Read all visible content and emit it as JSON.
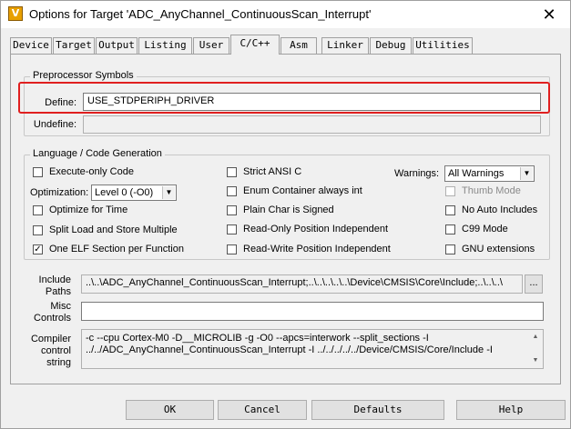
{
  "window": {
    "title": "Options for Target 'ADC_AnyChannel_ContinuousScan_Interrupt'",
    "app_icon_glyph": "V",
    "close_glyph": "✕"
  },
  "tabs": [
    "Device",
    "Target",
    "Output",
    "Listing",
    "User",
    "C/C++",
    "Asm",
    "Linker",
    "Debug",
    "Utilities"
  ],
  "active_tab": "C/C++",
  "preprocessor": {
    "group_title": "Preprocessor Symbols",
    "define_label": "Define:",
    "define_value": "USE_STDPERIPH_DRIVER",
    "undefine_label": "Undefine:",
    "undefine_value": ""
  },
  "language": {
    "group_title": "Language / Code Generation",
    "execute_only": {
      "label": "Execute-only Code",
      "checked": false
    },
    "optimization_label": "Optimization:",
    "optimization_value": "Level 0 (-O0)",
    "optimize_time": {
      "label": "Optimize for Time",
      "checked": false
    },
    "split_load": {
      "label": "Split Load and Store Multiple",
      "checked": false
    },
    "one_elf": {
      "label": "One ELF Section per Function",
      "checked": true
    },
    "strict_ansi": {
      "label": "Strict ANSI C",
      "checked": false
    },
    "enum_container": {
      "label": "Enum Container always int",
      "checked": false
    },
    "plain_char": {
      "label": "Plain Char is Signed",
      "checked": false
    },
    "ro_pos": {
      "label": "Read-Only Position Independent",
      "checked": false
    },
    "rw_pos": {
      "label": "Read-Write Position Independent",
      "checked": false
    },
    "warnings_label": "Warnings:",
    "warnings_value": "All Warnings",
    "thumb_mode": {
      "label": "Thumb Mode",
      "checked": false,
      "disabled": true
    },
    "no_auto_includes": {
      "label": "No Auto Includes",
      "checked": false
    },
    "c99_mode": {
      "label": "C99 Mode",
      "checked": false
    },
    "gnu_extensions": {
      "label": "GNU extensions",
      "checked": false
    }
  },
  "include": {
    "label_line1": "Include",
    "label_line2": "Paths",
    "value": "..\\..\\ADC_AnyChannel_ContinuousScan_Interrupt;..\\..\\..\\..\\..\\Device\\CMSIS\\Core\\Include;..\\..\\..\\",
    "browse_label": "..."
  },
  "misc": {
    "label_line1": "Misc",
    "label_line2": "Controls",
    "value": ""
  },
  "compiler": {
    "label_line1": "Compiler",
    "label_line2": "control",
    "label_line3": "string",
    "line1": "-c --cpu Cortex-M0 -D__MICROLIB -g -O0 --apcs=interwork --split_sections -I",
    "line2": "../../ADC_AnyChannel_ContinuousScan_Interrupt -I ../../../../../Device/CMSIS/Core/Include -I"
  },
  "buttons": {
    "ok": "OK",
    "cancel": "Cancel",
    "defaults": "Defaults",
    "help": "Help"
  },
  "colors": {
    "highlight": "#e01f1f"
  }
}
